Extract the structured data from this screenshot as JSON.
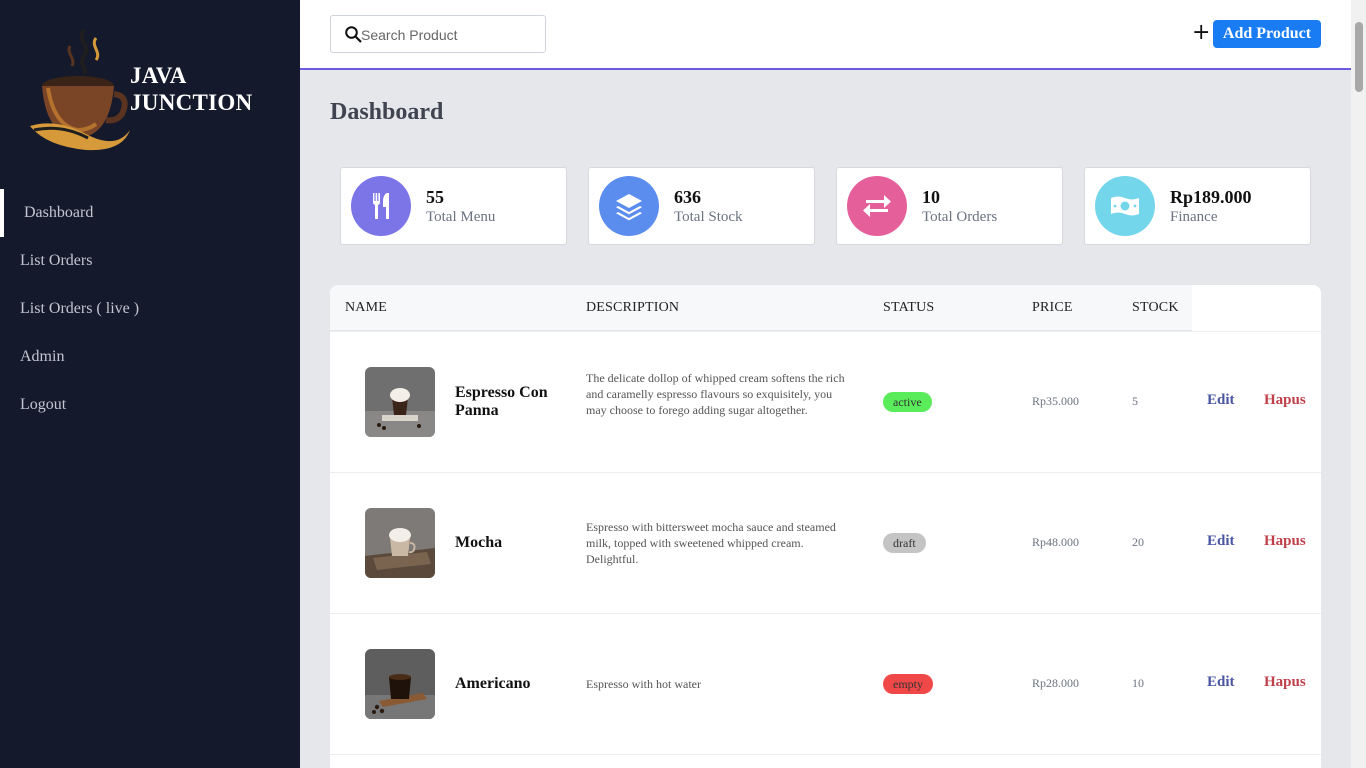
{
  "brand": {
    "line1": "JAVA",
    "line2": "JUNCTION"
  },
  "sidebar": {
    "items": [
      {
        "label": "Dashboard",
        "active": true
      },
      {
        "label": "List Orders"
      },
      {
        "label": "List Orders ( live )"
      },
      {
        "label": "Admin"
      },
      {
        "label": "Logout"
      }
    ]
  },
  "header": {
    "search_placeholder": "Search Product",
    "add_label": "Add Product",
    "plus_icon": "plus-icon"
  },
  "page": {
    "title": "Dashboard"
  },
  "stats": [
    {
      "value": "55",
      "label": "Total Menu",
      "icon": "utensils-icon",
      "color": "#7b75e8"
    },
    {
      "value": "636",
      "label": "Total Stock",
      "icon": "layers-icon",
      "color": "#5b8def"
    },
    {
      "value": "10",
      "label": "Total Orders",
      "icon": "exchange-icon",
      "color": "#e55f9b"
    },
    {
      "value": "Rp189.000",
      "label": "Finance",
      "icon": "money-icon",
      "color": "#74d6ea"
    }
  ],
  "table": {
    "headers": [
      "NAME",
      "DESCRIPTION",
      "STATUS",
      "PRICE",
      "STOCK"
    ],
    "edit_label": "Edit",
    "delete_label": "Hapus",
    "rows": [
      {
        "name": "Espresso Con Panna",
        "description": "The delicate dollop of whipped cream softens the rich and caramelly espresso flavours so exquisitely, you may choose to forego adding sugar altogether.",
        "status": "active",
        "status_color": "#5aec5a",
        "price": "Rp35.000",
        "stock": "5"
      },
      {
        "name": "Mocha",
        "description": "Espresso with bittersweet mocha sauce and steamed milk, topped with sweetened whipped cream. Delightful.",
        "status": "draft",
        "status_color": "#c4c4c4",
        "price": "Rp48.000",
        "stock": "20"
      },
      {
        "name": "Americano",
        "description": "Espresso with hot water",
        "status": "empty",
        "status_color": "#f04848",
        "price": "Rp28.000",
        "stock": "10"
      }
    ]
  }
}
